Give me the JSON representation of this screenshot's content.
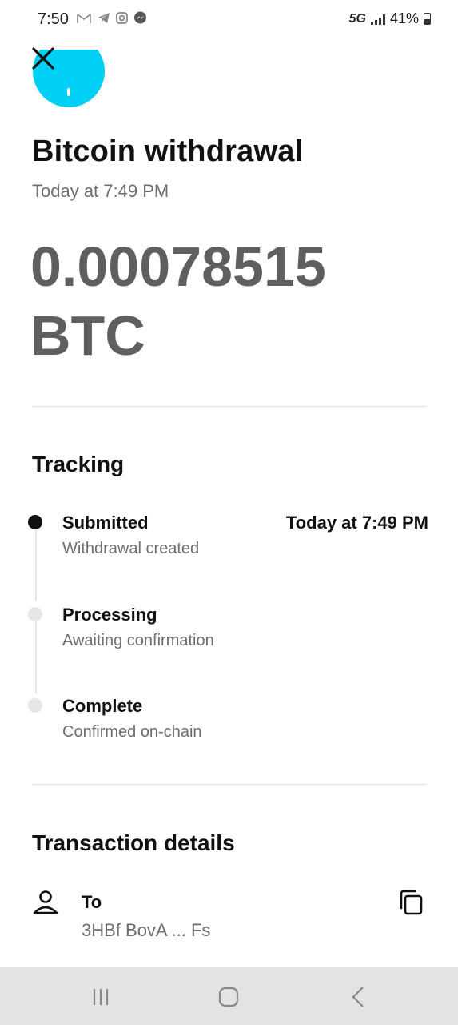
{
  "status_bar": {
    "time": "7:50",
    "network": "5G",
    "battery": "41%",
    "icons": [
      "gmail-icon",
      "telegram-icon",
      "instagram-icon",
      "messenger-icon",
      "signal-icon",
      "battery-icon"
    ]
  },
  "header": {
    "close_icon": "close-icon",
    "avatar_color": "#00d0f5"
  },
  "transaction": {
    "title": "Bitcoin withdrawal",
    "timestamp": "Today at 7:49 PM",
    "amount": "0.00078515 BTC"
  },
  "tracking": {
    "heading": "Tracking",
    "steps": [
      {
        "title": "Submitted",
        "subtitle": "Withdrawal created",
        "time": "Today at 7:49 PM",
        "status": "done"
      },
      {
        "title": "Processing",
        "subtitle": "Awaiting confirmation",
        "time": "",
        "status": "pending"
      },
      {
        "title": "Complete",
        "subtitle": "Confirmed on-chain",
        "time": "",
        "status": "pending"
      }
    ]
  },
  "details": {
    "heading": "Transaction details",
    "to_label": "To",
    "to_address": "3HBf BovA ... Fs"
  },
  "nav": {
    "buttons": [
      "recent-apps-icon",
      "home-icon",
      "back-icon"
    ]
  },
  "colors": {
    "accent": "#00d0f5",
    "amount_text": "#5f5f5f",
    "muted_text": "#6e6e6e",
    "nav_background": "#e3e3e3"
  }
}
